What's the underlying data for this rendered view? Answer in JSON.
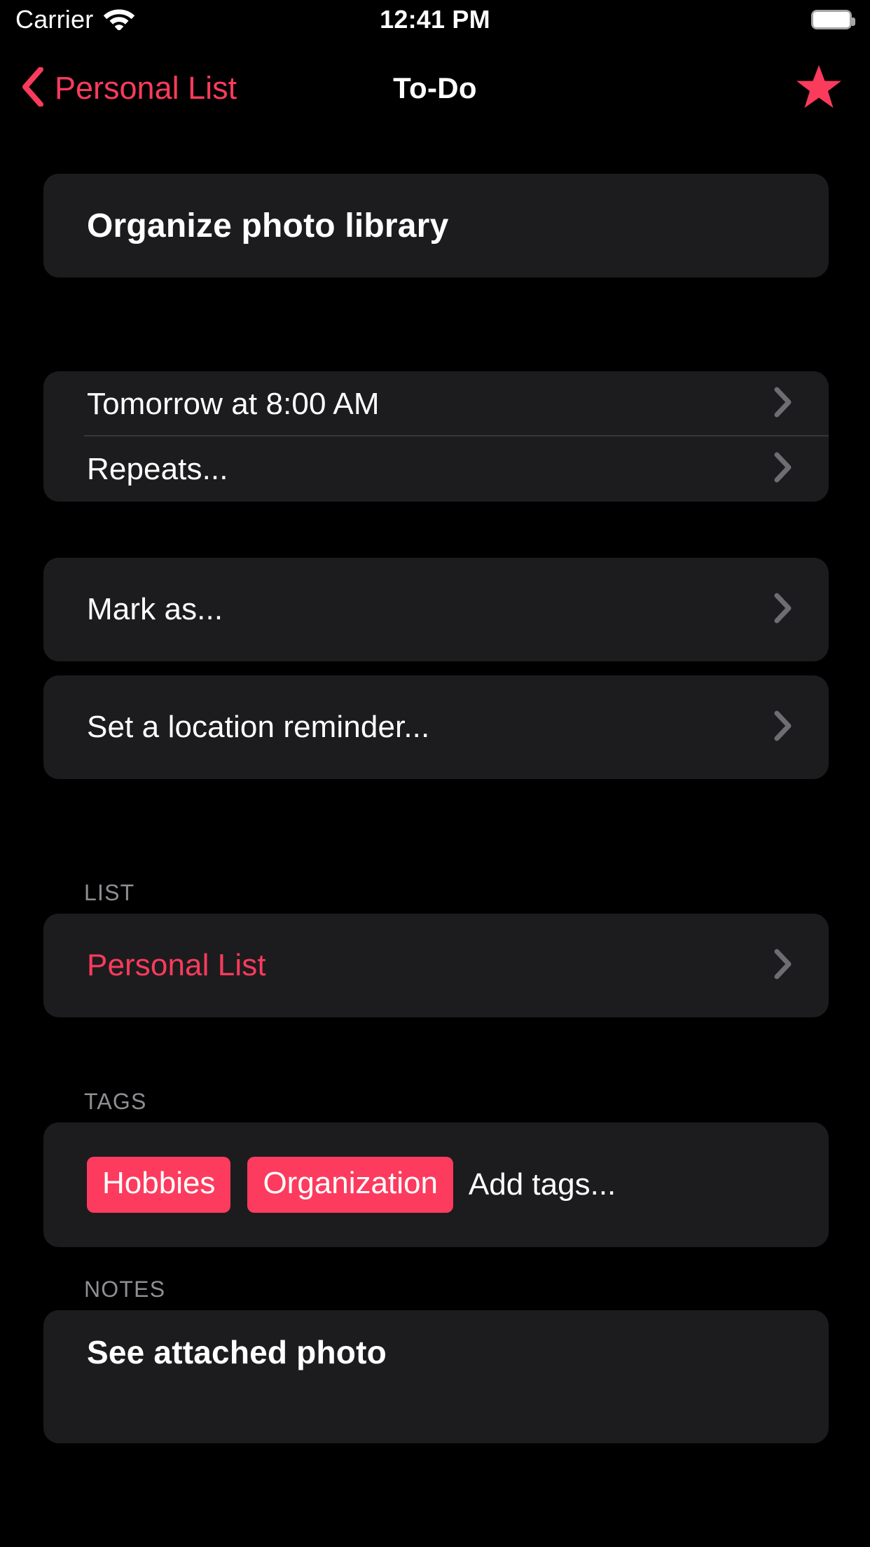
{
  "status_bar": {
    "carrier": "Carrier",
    "wifi_icon": "wifi-icon",
    "time": "12:41 PM",
    "battery_icon": "battery-full-icon"
  },
  "nav_bar": {
    "back_icon": "chevron-left-icon",
    "back_label": "Personal List",
    "title": "To-Do",
    "star_icon": "star-filled-icon"
  },
  "task": {
    "title": "Organize photo library"
  },
  "schedule": {
    "due_label": "Tomorrow at 8:00 AM",
    "repeats_label": "Repeats..."
  },
  "mark": {
    "label": "Mark as..."
  },
  "location": {
    "label": "Set a location reminder..."
  },
  "list_section": {
    "header": "LIST",
    "value": "Personal List"
  },
  "tags_section": {
    "header": "TAGS",
    "tags": [
      "Hobbies",
      "Organization"
    ],
    "add_label": "Add tags..."
  },
  "notes_section": {
    "header": "NOTES",
    "text": "See attached photo"
  },
  "colors": {
    "background": "#000000",
    "card": "#1C1C1E",
    "accent": "#FA3B5C",
    "tag": "#FC3B5E",
    "separator": "#38383A",
    "secondary_text": "#8E8E93",
    "chevron": "#6D6D72"
  },
  "icons": {
    "chevron_right": "chevron-right-icon"
  }
}
